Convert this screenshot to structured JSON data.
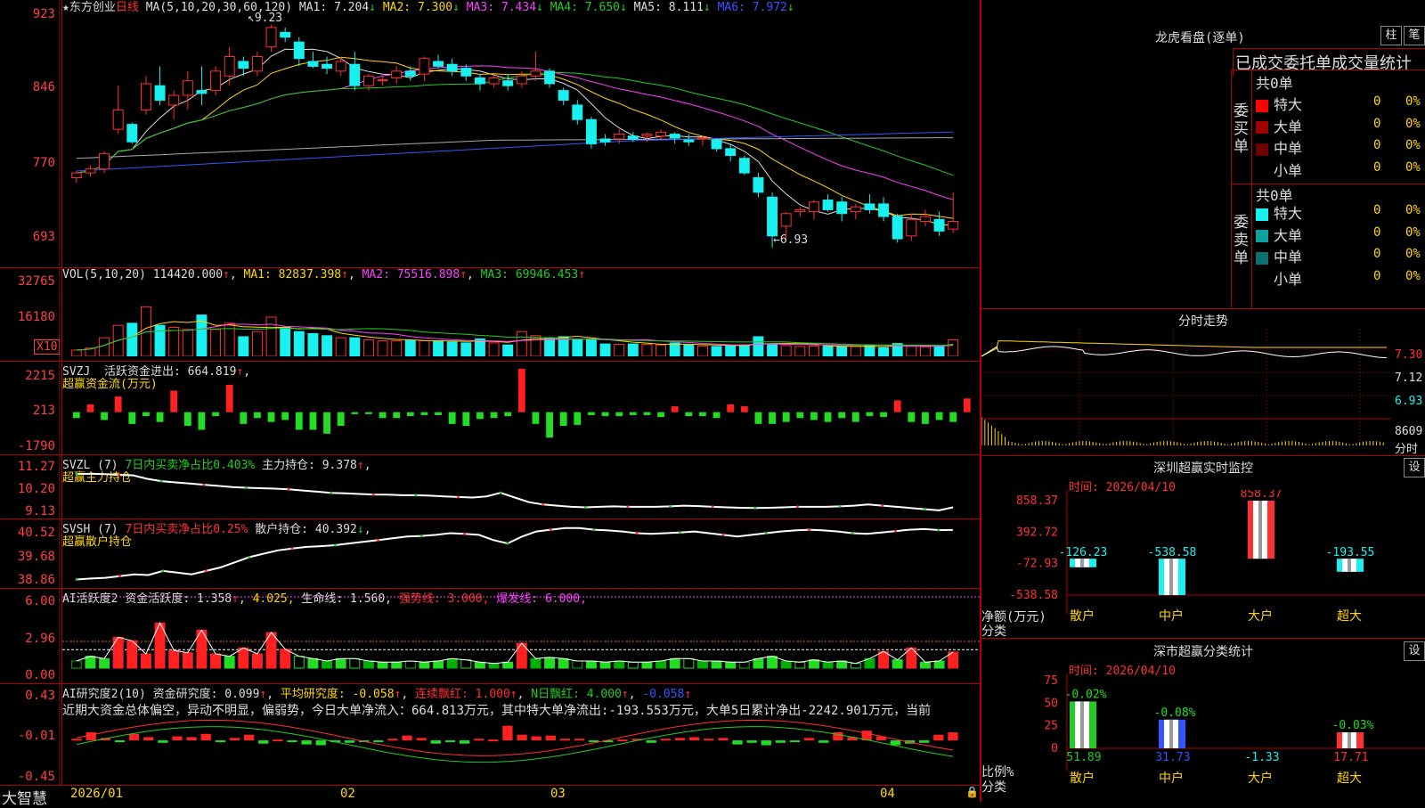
{
  "header": {
    "star": "★",
    "stock_name": "东方创业",
    "period": "日线",
    "ma_title": "MA(5,10,20,30,60,120)",
    "ma": [
      {
        "label": "MA1:",
        "value": "7.204",
        "arrow": "↓",
        "color": "#dddddd"
      },
      {
        "label": "MA2:",
        "value": "7.300",
        "arrow": "↓",
        "color": "#ffd700"
      },
      {
        "label": "MA3:",
        "value": "7.434",
        "arrow": "↓",
        "color": "#ff40ff"
      },
      {
        "label": "MA4:",
        "value": "7.650",
        "arrow": "↓",
        "color": "#22cc22"
      },
      {
        "label": "MA5:",
        "value": "8.111",
        "arrow": "↓",
        "color": "#dddddd"
      },
      {
        "label": "MA6:",
        "value": "7.972",
        "arrow": "↓",
        "color": "#3355ff"
      }
    ],
    "high_mark": "9.23",
    "low_mark": "6.93"
  },
  "price_axis": [
    "923",
    "846",
    "770",
    "693"
  ],
  "volume": {
    "title": "VOL(5,10,20)",
    "value": "114420.000",
    "ma1_label": "MA1:",
    "ma1": "82837.398",
    "ma2_label": "MA2:",
    "ma2": "75516.898",
    "ma3_label": "MA3:",
    "ma3": "69946.453",
    "axis": [
      "32765",
      "16180"
    ],
    "unit": "X10"
  },
  "svzj": {
    "title": "SVZJ",
    "label": "活跃资金进出:",
    "value": "664.819",
    "sub": "超赢资金流(万元)",
    "axis": [
      "2215",
      "213",
      "-1790"
    ]
  },
  "svzl": {
    "title": "SVZL (7)",
    "ratio": "7日内买卖净占比0.403%",
    "label": "主力持仓:",
    "value": "9.378",
    "sub": "超赢主力持仓",
    "axis": [
      "11.27",
      "10.20",
      "9.13"
    ]
  },
  "svsh": {
    "title": "SVSH (7)",
    "ratio": "7日内买卖净占比0.25%",
    "label": "散户持仓:",
    "value": "40.392",
    "sub": "超赢散户持仓",
    "axis": [
      "40.52",
      "39.68",
      "38.86"
    ]
  },
  "ai_active": {
    "title": "AI活跃度2",
    "label": "资金活跃度:",
    "value": "1.358",
    "v2": "4.025,",
    "life_label": "生命线:",
    "life": "1.560,",
    "strong_label": "强势线:",
    "strong": "3.000,",
    "burst_label": "爆发线:",
    "burst": "6.000,",
    "axis": [
      "6.00",
      "2.96",
      "0.00"
    ]
  },
  "ai_research": {
    "title": "AI研究度2(10)",
    "label": "资金研究度:",
    "value": "0.099",
    "avg_label": "平均研究度:",
    "avg": "-0.058",
    "cont_label": "连续飘红:",
    "cont": "1.000",
    "n_label": "N日飘红:",
    "n": "4.000",
    "last": "-0.058",
    "comment": "近期大资金总体偏空，异动不明显，偏弱势，今日大单净流入：664.813万元，其中特大单净流出:-193.553万元，大单5日累计净出-2242.901万元，当前",
    "axis": [
      "0.43",
      "-0.01",
      "-0.45"
    ]
  },
  "date_axis": {
    "logo": "大智慧",
    "ticks": [
      "2026/01",
      "02",
      "03",
      "04"
    ]
  },
  "right": {
    "longhu_title": "龙虎看盘(逐单)",
    "btn1": "柱",
    "btn2": "笔",
    "tabs_title": "已成交委托单成交量统计",
    "buy_side": "委买单",
    "sell_side": "委卖单",
    "buy_total": "共0单",
    "sell_total": "共0单",
    "buy_rows": [
      {
        "name": "特大",
        "count": "0",
        "pct": "0%",
        "color": "#ff0000"
      },
      {
        "name": "大单",
        "count": "0",
        "pct": "0%",
        "color": "#a00000"
      },
      {
        "name": "中单",
        "count": "0",
        "pct": "0%",
        "color": "#700000"
      },
      {
        "name": "小单",
        "count": "0",
        "pct": "0%",
        "color": "#000000"
      }
    ],
    "sell_rows": [
      {
        "name": "特大",
        "count": "0",
        "pct": "0%",
        "color": "#19f0f0"
      },
      {
        "name": "大单",
        "count": "0",
        "pct": "0%",
        "color": "#10a0a0"
      },
      {
        "name": "中单",
        "count": "0",
        "pct": "0%",
        "color": "#0b7070"
      },
      {
        "name": "小单",
        "count": "0",
        "pct": "0%",
        "color": "#000000"
      }
    ],
    "intraday_title": "分时走势",
    "intraday_axis": [
      "7.30",
      "7.12",
      "6.93",
      "8609",
      "分时"
    ],
    "monitor_title": "深圳超赢实时监控",
    "set": "设",
    "monitor_time": "时间: 2026/04/10",
    "monitor_axis": [
      "858.37",
      "392.72",
      "-72.93",
      "-538.58"
    ],
    "monitor_unit": "净额(万元)",
    "monitor_cat": "分类",
    "monitor_bars": [
      {
        "name": "散户",
        "value": -126.23,
        "label": "-126.23",
        "color": "#19f0f0"
      },
      {
        "name": "中户",
        "value": -538.58,
        "label": "-538.58",
        "color": "#19f0f0"
      },
      {
        "name": "大户",
        "value": 858.37,
        "label": "858.37",
        "color": "#ff3030"
      },
      {
        "name": "超大",
        "value": -193.55,
        "label": "-193.55",
        "color": "#19f0f0"
      }
    ],
    "stat_title": "深市超赢分类统计",
    "stat_time": "时间: 2026/04/10",
    "stat_axis": [
      "75",
      "50",
      "25",
      "0"
    ],
    "stat_unit": "比例%",
    "stat_cat": "分类",
    "stat_bars": [
      {
        "name": "散户",
        "value": 51.89,
        "label": "51.89",
        "top": "-0.02%",
        "color": "#22cc22"
      },
      {
        "name": "中户",
        "value": 31.73,
        "label": "31.73",
        "top": "-0.08%",
        "color": "#3355ff"
      },
      {
        "name": "大户",
        "value": -1.33,
        "label": "-1.33",
        "top": "",
        "color": "#19f0f0"
      },
      {
        "name": "超大",
        "value": 17.71,
        "label": "17.71",
        "top": "-0.03%",
        "color": "#ff3030"
      }
    ]
  },
  "chart_data": [
    {
      "type": "candlestick",
      "title": "东方创业 日线",
      "note": "daily OHLC approximated from the chart, Dec 2025 – Apr 10 2026",
      "ylim": [
        6.8,
        9.3
      ],
      "candles": [
        [
          7.65,
          7.72,
          7.6,
          7.7
        ],
        [
          7.7,
          7.78,
          7.66,
          7.74
        ],
        [
          7.74,
          7.92,
          7.7,
          7.9
        ],
        [
          8.15,
          8.6,
          8.1,
          8.35
        ],
        [
          8.2,
          8.22,
          8.0,
          8.02
        ],
        [
          8.35,
          8.7,
          8.3,
          8.62
        ],
        [
          8.6,
          8.8,
          8.4,
          8.45
        ],
        [
          8.4,
          8.55,
          8.25,
          8.5
        ],
        [
          8.5,
          8.75,
          8.35,
          8.65
        ],
        [
          8.55,
          8.8,
          8.4,
          8.52
        ],
        [
          8.55,
          8.8,
          8.5,
          8.75
        ],
        [
          8.7,
          9.0,
          8.6,
          8.9
        ],
        [
          8.85,
          8.9,
          8.7,
          8.78
        ],
        [
          8.75,
          8.95,
          8.7,
          8.9
        ],
        [
          9.0,
          9.23,
          8.95,
          9.2
        ],
        [
          9.15,
          9.2,
          9.05,
          9.1
        ],
        [
          9.05,
          9.1,
          8.8,
          8.88
        ],
        [
          8.85,
          8.95,
          8.78,
          8.8
        ],
        [
          8.82,
          8.9,
          8.72,
          8.78
        ],
        [
          8.75,
          8.9,
          8.7,
          8.85
        ],
        [
          8.82,
          8.95,
          8.55,
          8.6
        ],
        [
          8.6,
          8.72,
          8.55,
          8.7
        ],
        [
          8.65,
          8.7,
          8.6,
          8.66
        ],
        [
          8.68,
          8.8,
          8.62,
          8.75
        ],
        [
          8.75,
          8.8,
          8.65,
          8.7
        ],
        [
          8.72,
          8.9,
          8.65,
          8.88
        ],
        [
          8.85,
          8.92,
          8.78,
          8.8
        ],
        [
          8.82,
          8.88,
          8.7,
          8.75
        ],
        [
          8.78,
          8.82,
          8.65,
          8.7
        ],
        [
          8.68,
          8.72,
          8.55,
          8.62
        ],
        [
          8.62,
          8.72,
          8.58,
          8.68
        ],
        [
          8.65,
          8.72,
          8.55,
          8.6
        ],
        [
          8.62,
          8.75,
          8.58,
          8.7
        ],
        [
          8.7,
          8.95,
          8.65,
          8.75
        ],
        [
          8.75,
          8.78,
          8.58,
          8.62
        ],
        [
          8.55,
          8.58,
          8.4,
          8.45
        ],
        [
          8.4,
          8.45,
          8.2,
          8.25
        ],
        [
          8.25,
          8.28,
          7.95,
          8.0
        ],
        [
          8.05,
          8.1,
          7.98,
          8.02
        ],
        [
          8.05,
          8.15,
          8.0,
          8.1
        ],
        [
          8.08,
          8.12,
          8.02,
          8.05
        ],
        [
          8.08,
          8.12,
          8.02,
          8.1
        ],
        [
          8.08,
          8.15,
          8.05,
          8.12
        ],
        [
          8.1,
          8.12,
          8.0,
          8.06
        ],
        [
          8.04,
          8.1,
          7.98,
          8.02
        ],
        [
          8.05,
          8.08,
          7.98,
          8.06
        ],
        [
          8.04,
          8.06,
          7.92,
          7.95
        ],
        [
          7.95,
          8.0,
          7.82,
          7.88
        ],
        [
          7.85,
          7.88,
          7.68,
          7.7
        ],
        [
          7.65,
          7.7,
          7.45,
          7.5
        ],
        [
          7.45,
          7.5,
          6.93,
          7.05
        ],
        [
          7.15,
          7.3,
          7.0,
          7.28
        ],
        [
          7.3,
          7.35,
          7.25,
          7.32
        ],
        [
          7.3,
          7.42,
          7.22,
          7.4
        ],
        [
          7.42,
          7.48,
          7.3,
          7.32
        ],
        [
          7.4,
          7.45,
          7.2,
          7.28
        ],
        [
          7.3,
          7.38,
          7.22,
          7.35
        ],
        [
          7.38,
          7.48,
          7.28,
          7.32
        ],
        [
          7.38,
          7.45,
          7.2,
          7.25
        ],
        [
          7.25,
          7.28,
          6.98,
          7.02
        ],
        [
          7.05,
          7.28,
          7.0,
          7.22
        ],
        [
          7.2,
          7.32,
          7.15,
          7.25
        ],
        [
          7.22,
          7.3,
          7.05,
          7.1
        ],
        [
          7.12,
          7.5,
          7.08,
          7.2
        ]
      ]
    },
    {
      "type": "bar",
      "title": "VOL(5,10,20)",
      "ylim": [
        0,
        32765
      ],
      "values": [
        3000,
        4000,
        9000,
        15000,
        16000,
        24000,
        15000,
        14000,
        13000,
        20000,
        13000,
        16000,
        9500,
        12000,
        19000,
        14000,
        12000,
        11000,
        10000,
        9000,
        9000,
        8000,
        7500,
        7500,
        7800,
        7600,
        7400,
        7000,
        6500,
        8500,
        6500,
        5500,
        12000,
        10000,
        9000,
        9500,
        8000,
        8500,
        6000,
        5800,
        6000,
        5800,
        5500,
        6500,
        5500,
        5000,
        4800,
        5000,
        5600,
        9500,
        5800,
        5200,
        4800,
        5000,
        4900,
        4600,
        4800,
        5200,
        4200,
        6200,
        4900,
        4600,
        5200,
        8000
      ]
    },
    {
      "type": "bar",
      "title": "SVZJ 活跃资金进出",
      "ylim": [
        -1790,
        2215
      ],
      "values": [
        -300,
        400,
        -400,
        800,
        -600,
        -200,
        -500,
        1100,
        -700,
        -900,
        -200,
        1400,
        -600,
        -300,
        -500,
        -400,
        -900,
        -900,
        -1100,
        -700,
        -100,
        -100,
        -300,
        -300,
        -200,
        -150,
        -150,
        -600,
        -700,
        -350,
        -300,
        -200,
        2215,
        -600,
        -1300,
        -700,
        -650,
        -150,
        -200,
        -200,
        -150,
        -150,
        -250,
        300,
        -200,
        -200,
        -300,
        400,
        300,
        -600,
        -600,
        -500,
        -300,
        -400,
        -500,
        -300,
        -500,
        -200,
        -250,
        600,
        -500,
        -600,
        -400,
        -500,
        700
      ]
    },
    {
      "type": "line",
      "title": "SVZL 主力持仓",
      "ylim": [
        9.13,
        11.27
      ],
      "values": [
        10.8,
        10.82,
        10.8,
        10.78,
        10.75,
        10.6,
        10.5,
        10.45,
        10.4,
        10.35,
        10.3,
        10.25,
        10.22,
        10.2,
        10.18,
        10.15,
        10.1,
        10.05,
        10.0,
        9.98,
        9.95,
        9.93,
        9.92,
        9.9,
        9.9,
        9.88,
        9.85,
        9.82,
        9.8,
        9.85,
        10.0,
        9.8,
        9.6,
        9.5,
        9.45,
        9.4,
        9.38,
        9.4,
        9.42,
        9.4,
        9.4,
        9.4,
        9.42,
        9.45,
        9.43,
        9.4,
        9.38,
        9.36,
        9.35,
        9.36,
        9.38,
        9.4,
        9.4,
        9.4,
        9.42,
        9.45,
        9.5,
        9.45,
        9.4,
        9.35,
        9.3,
        9.25,
        9.378
      ]
    },
    {
      "type": "line",
      "title": "SVSH 散户持仓",
      "ylim": [
        38.86,
        40.52
      ],
      "values": [
        38.95,
        38.98,
        39.0,
        39.05,
        39.1,
        39.08,
        39.2,
        39.15,
        39.1,
        39.2,
        39.3,
        39.45,
        39.6,
        39.7,
        39.8,
        39.85,
        39.9,
        39.92,
        39.95,
        40.0,
        40.05,
        40.1,
        40.15,
        40.2,
        40.22,
        40.25,
        40.3,
        40.28,
        40.25,
        40.1,
        40.0,
        40.2,
        40.35,
        40.4,
        40.45,
        40.45,
        40.4,
        40.38,
        40.35,
        40.3,
        40.28,
        40.3,
        40.32,
        40.35,
        40.3,
        40.25,
        40.2,
        40.25,
        40.3,
        40.35,
        40.38,
        40.4,
        40.38,
        40.35,
        40.3,
        40.28,
        40.32,
        40.36,
        40.4,
        40.42,
        40.39,
        40.392
      ]
    },
    {
      "type": "bar",
      "title": "AI活跃度2 资金活跃度",
      "ylim": [
        0,
        6.0
      ],
      "values": [
        0.6,
        1.0,
        0.8,
        2.6,
        2.3,
        1.2,
        3.8,
        1.5,
        1.3,
        3.2,
        1.2,
        1.0,
        1.7,
        1.2,
        3.0,
        1.6,
        1.0,
        0.8,
        0.6,
        0.8,
        0.8,
        0.6,
        0.5,
        0.5,
        0.6,
        0.5,
        0.6,
        0.8,
        0.7,
        0.5,
        0.4,
        0.5,
        2.1,
        0.8,
        0.9,
        0.8,
        0.6,
        0.6,
        0.5,
        0.6,
        0.5,
        0.5,
        0.6,
        0.8,
        0.8,
        0.6,
        0.6,
        0.5,
        0.5,
        0.8,
        1.0,
        0.6,
        0.5,
        0.7,
        0.5,
        0.6,
        0.4,
        0.8,
        1.4,
        0.7,
        1.7,
        0.5,
        0.6,
        1.358
      ],
      "lines": {
        "strong": 3.0,
        "burst": 6.0,
        "life": 1.56
      }
    },
    {
      "type": "bar",
      "title": "AI研究度2(10) 资金研究度",
      "ylim": [
        -0.45,
        0.43
      ],
      "values": [
        0.02,
        0.1,
        0.03,
        -0.02,
        0.08,
        0.04,
        -0.03,
        0.05,
        0.04,
        0.08,
        -0.02,
        0.03,
        0.07,
        -0.04,
        0.01,
        -0.02,
        -0.05,
        -0.06,
        -0.02,
        -0.03,
        -0.02,
        -0.02,
        0.02,
        0.06,
        0.03,
        -0.04,
        -0.02,
        -0.04,
        0.02,
        0.01,
        0.18,
        0.07,
        0.05,
        0.06,
        0.02,
        0.02,
        -0.02,
        -0.02,
        0.01,
        0.02,
        -0.03,
        0.02,
        0.03,
        0.04,
        0.02,
        0.03,
        -0.05,
        -0.03,
        -0.06,
        -0.03,
        -0.02,
        0.03,
        -0.03,
        0.1,
        0.04,
        0.12,
        0.05,
        -0.06,
        -0.04,
        -0.03,
        0.07,
        0.099
      ]
    }
  ]
}
